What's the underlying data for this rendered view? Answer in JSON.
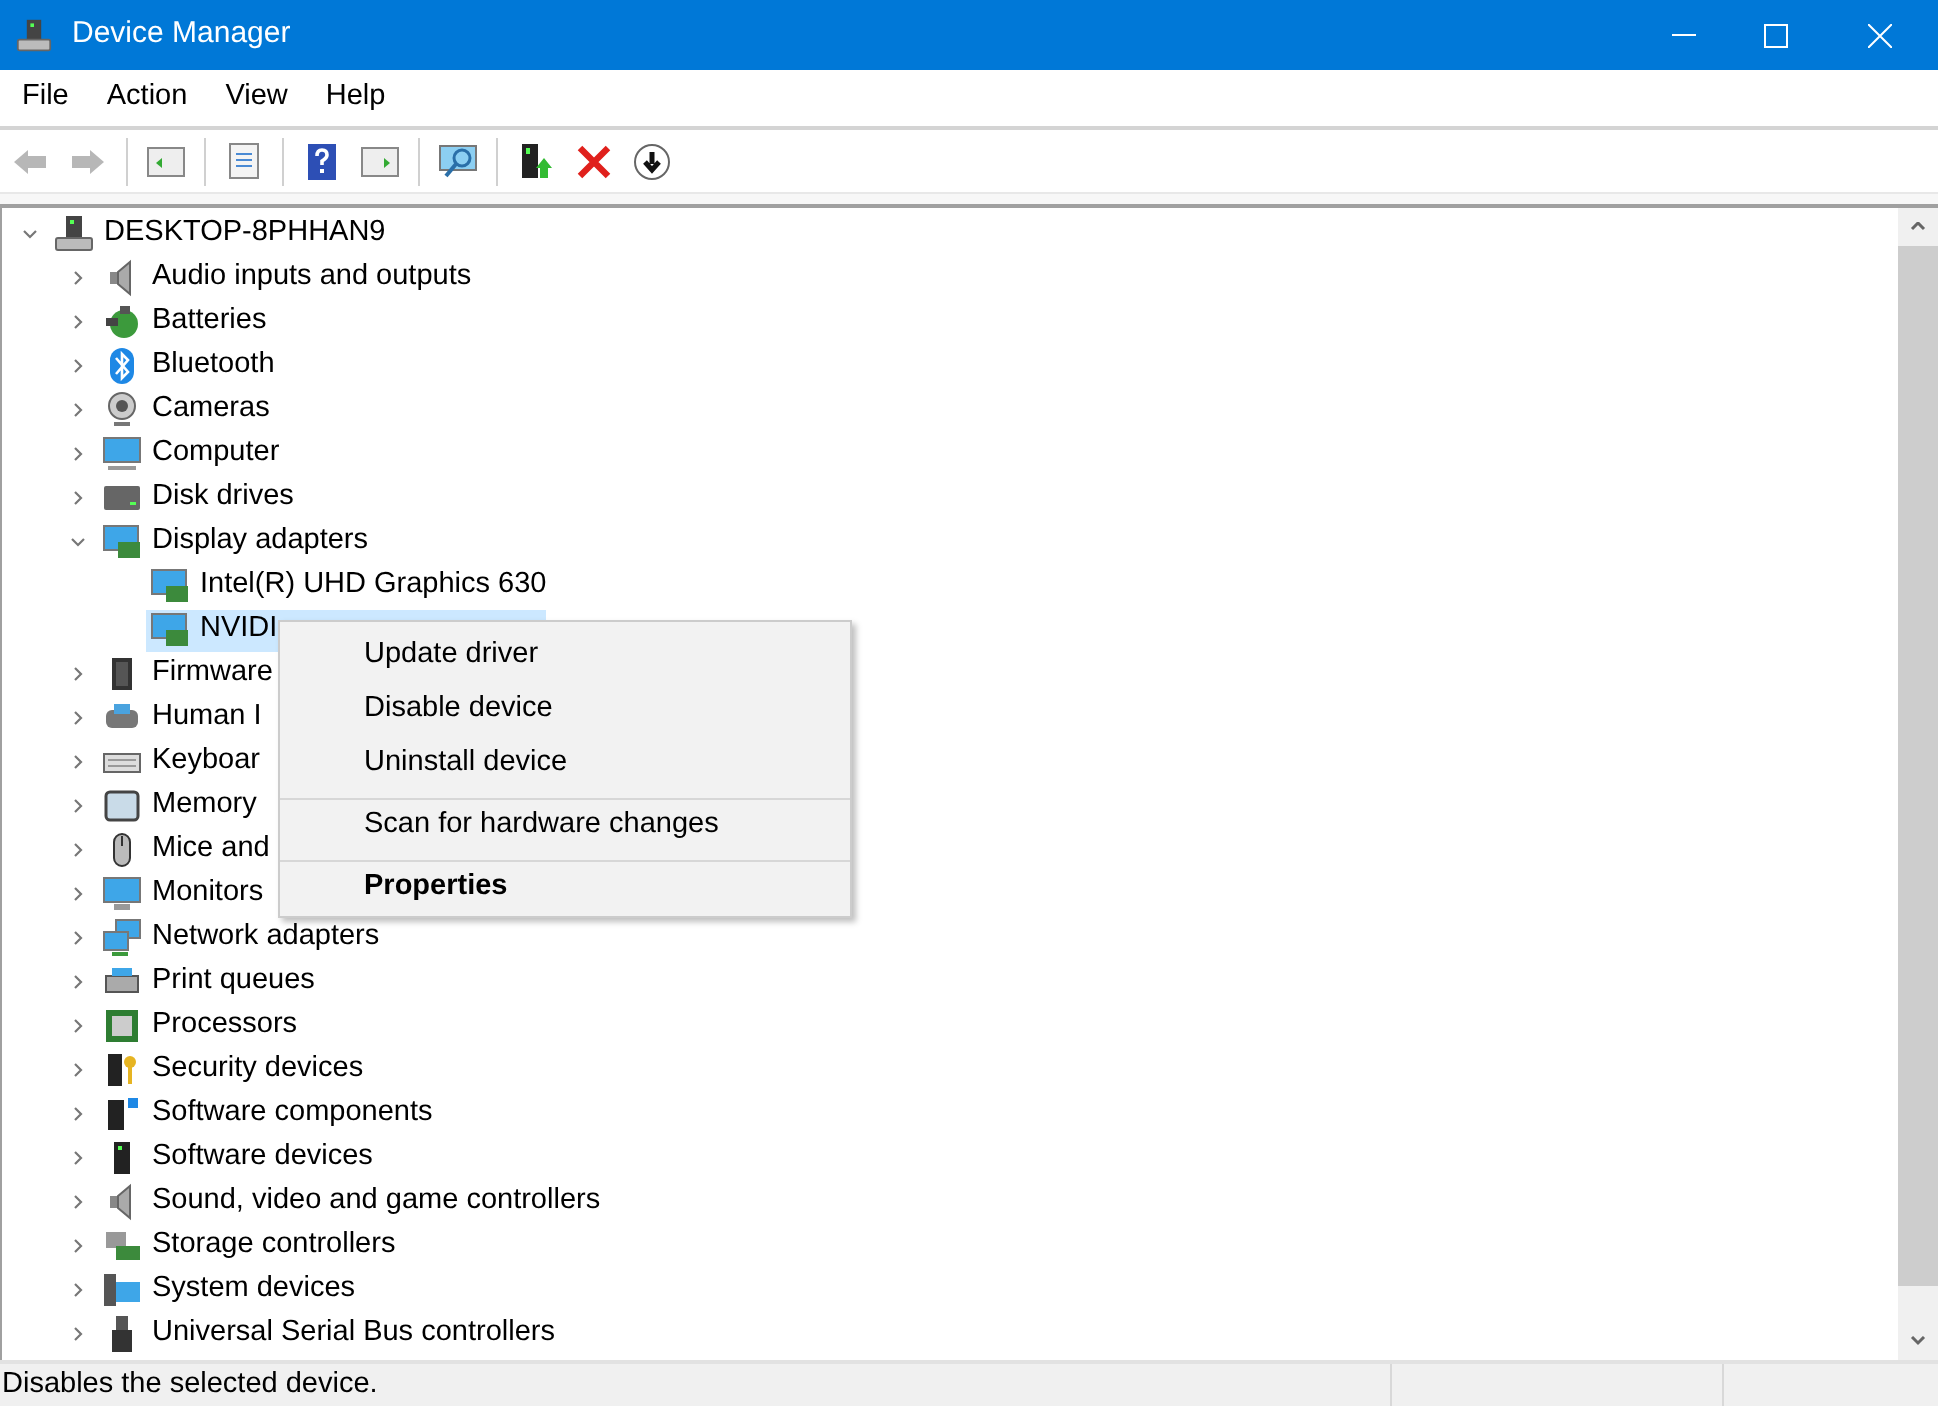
{
  "window": {
    "title": "Device Manager"
  },
  "menu_bar": [
    "File",
    "Action",
    "View",
    "Help"
  ],
  "toolbar": [
    {
      "disabled": true
    },
    {
      "disabled": true
    },
    {
      "disabled": false
    },
    {
      "disabled": false
    },
    {
      "disabled": false
    },
    {
      "disabled": false
    },
    {
      "disabled": false
    },
    {
      "disabled": false
    },
    {
      "disabled": false
    },
    {
      "disabled": false
    }
  ],
  "tree": {
    "label": "DESKTOP-8PHHAN9",
    "expanded": true,
    "children": [
      {
        "label": "Audio inputs and outputs",
        "expanded": false,
        "selected": false
      },
      {
        "label": "Batteries",
        "expanded": false,
        "selected": false
      },
      {
        "label": "Bluetooth",
        "expanded": false,
        "selected": false
      },
      {
        "label": "Cameras",
        "expanded": false,
        "selected": false
      },
      {
        "label": "Computer",
        "expanded": false,
        "selected": false
      },
      {
        "label": "Disk drives",
        "expanded": false,
        "selected": false
      },
      {
        "label": "Display adapters",
        "expanded": true,
        "selected": false,
        "children": [
          {
            "label": "Intel(R) UHD Graphics 630",
            "selected": false
          },
          {
            "label": "NVIDI",
            "selected": true
          }
        ]
      },
      {
        "label": "Firmware",
        "expanded": false,
        "selected": false
      },
      {
        "label": "Human I",
        "expanded": false,
        "selected": false
      },
      {
        "label": "Keyboar",
        "expanded": false,
        "selected": false
      },
      {
        "label": "Memory",
        "expanded": false,
        "selected": false
      },
      {
        "label": "Mice and",
        "expanded": false,
        "selected": false
      },
      {
        "label": "Monitors",
        "expanded": false,
        "selected": false
      },
      {
        "label": "Network adapters",
        "expanded": false,
        "selected": false
      },
      {
        "label": "Print queues",
        "expanded": false,
        "selected": false
      },
      {
        "label": "Processors",
        "expanded": false,
        "selected": false
      },
      {
        "label": "Security devices",
        "expanded": false,
        "selected": false
      },
      {
        "label": "Software components",
        "expanded": false,
        "selected": false
      },
      {
        "label": "Software devices",
        "expanded": false,
        "selected": false
      },
      {
        "label": "Sound, video and game controllers",
        "expanded": false,
        "selected": false
      },
      {
        "label": "Storage controllers",
        "expanded": false,
        "selected": false
      },
      {
        "label": "System devices",
        "expanded": false,
        "selected": false
      },
      {
        "label": "Universal Serial Bus controllers",
        "expanded": false,
        "selected": false
      }
    ]
  },
  "context_menu": [
    {
      "label": "Update driver",
      "bold": false,
      "separated": false
    },
    {
      "label": "Disable device",
      "bold": false,
      "separated": false
    },
    {
      "label": "Uninstall device",
      "bold": false,
      "separated": false
    },
    {
      "label": "Scan for hardware changes",
      "bold": false,
      "separated": true
    },
    {
      "label": "Properties",
      "bold": true,
      "separated": true
    }
  ],
  "status_bar": {
    "text": "Disables the selected device."
  }
}
